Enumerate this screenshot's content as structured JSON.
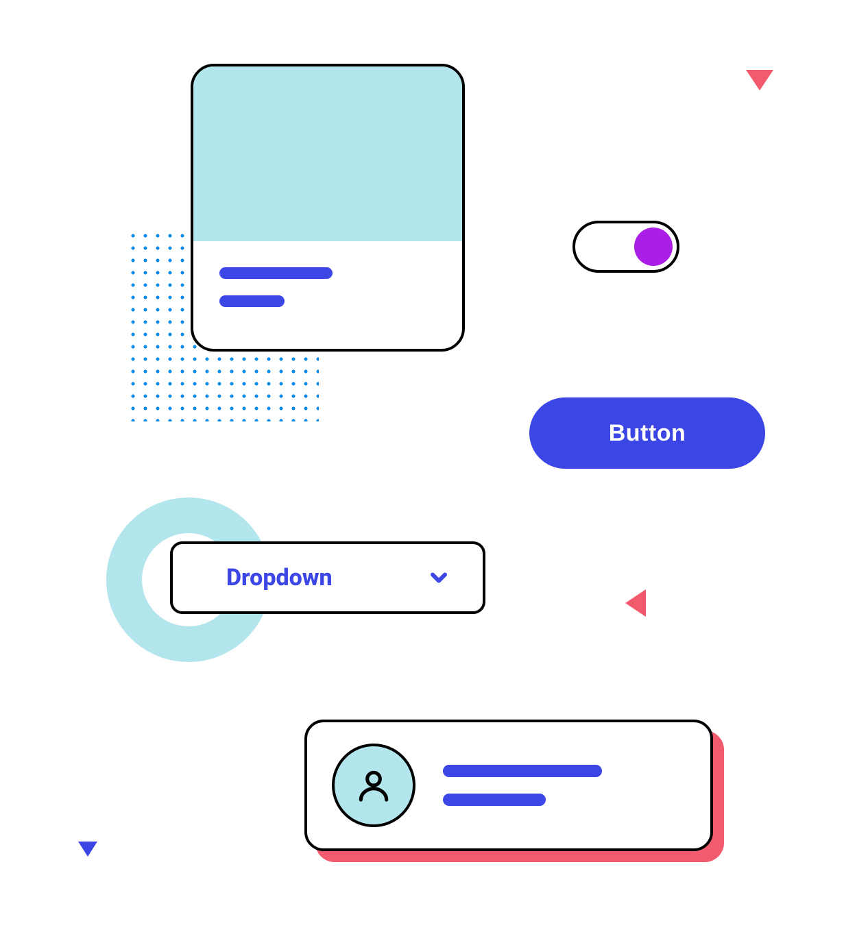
{
  "colors": {
    "primary": "#3C46E5",
    "accent_purple": "#A91FE5",
    "accent_pink": "#F25A6E",
    "accent_cyan": "#B3E5ED",
    "dot": "#0C8CE9",
    "border": "#000000",
    "bg": "#FFFFFF"
  },
  "card": {
    "has_image_placeholder": true
  },
  "toggle": {
    "state": "on"
  },
  "button": {
    "label": "Button"
  },
  "dropdown": {
    "label": "Dropdown"
  },
  "profile": {
    "icon": "person-icon"
  }
}
